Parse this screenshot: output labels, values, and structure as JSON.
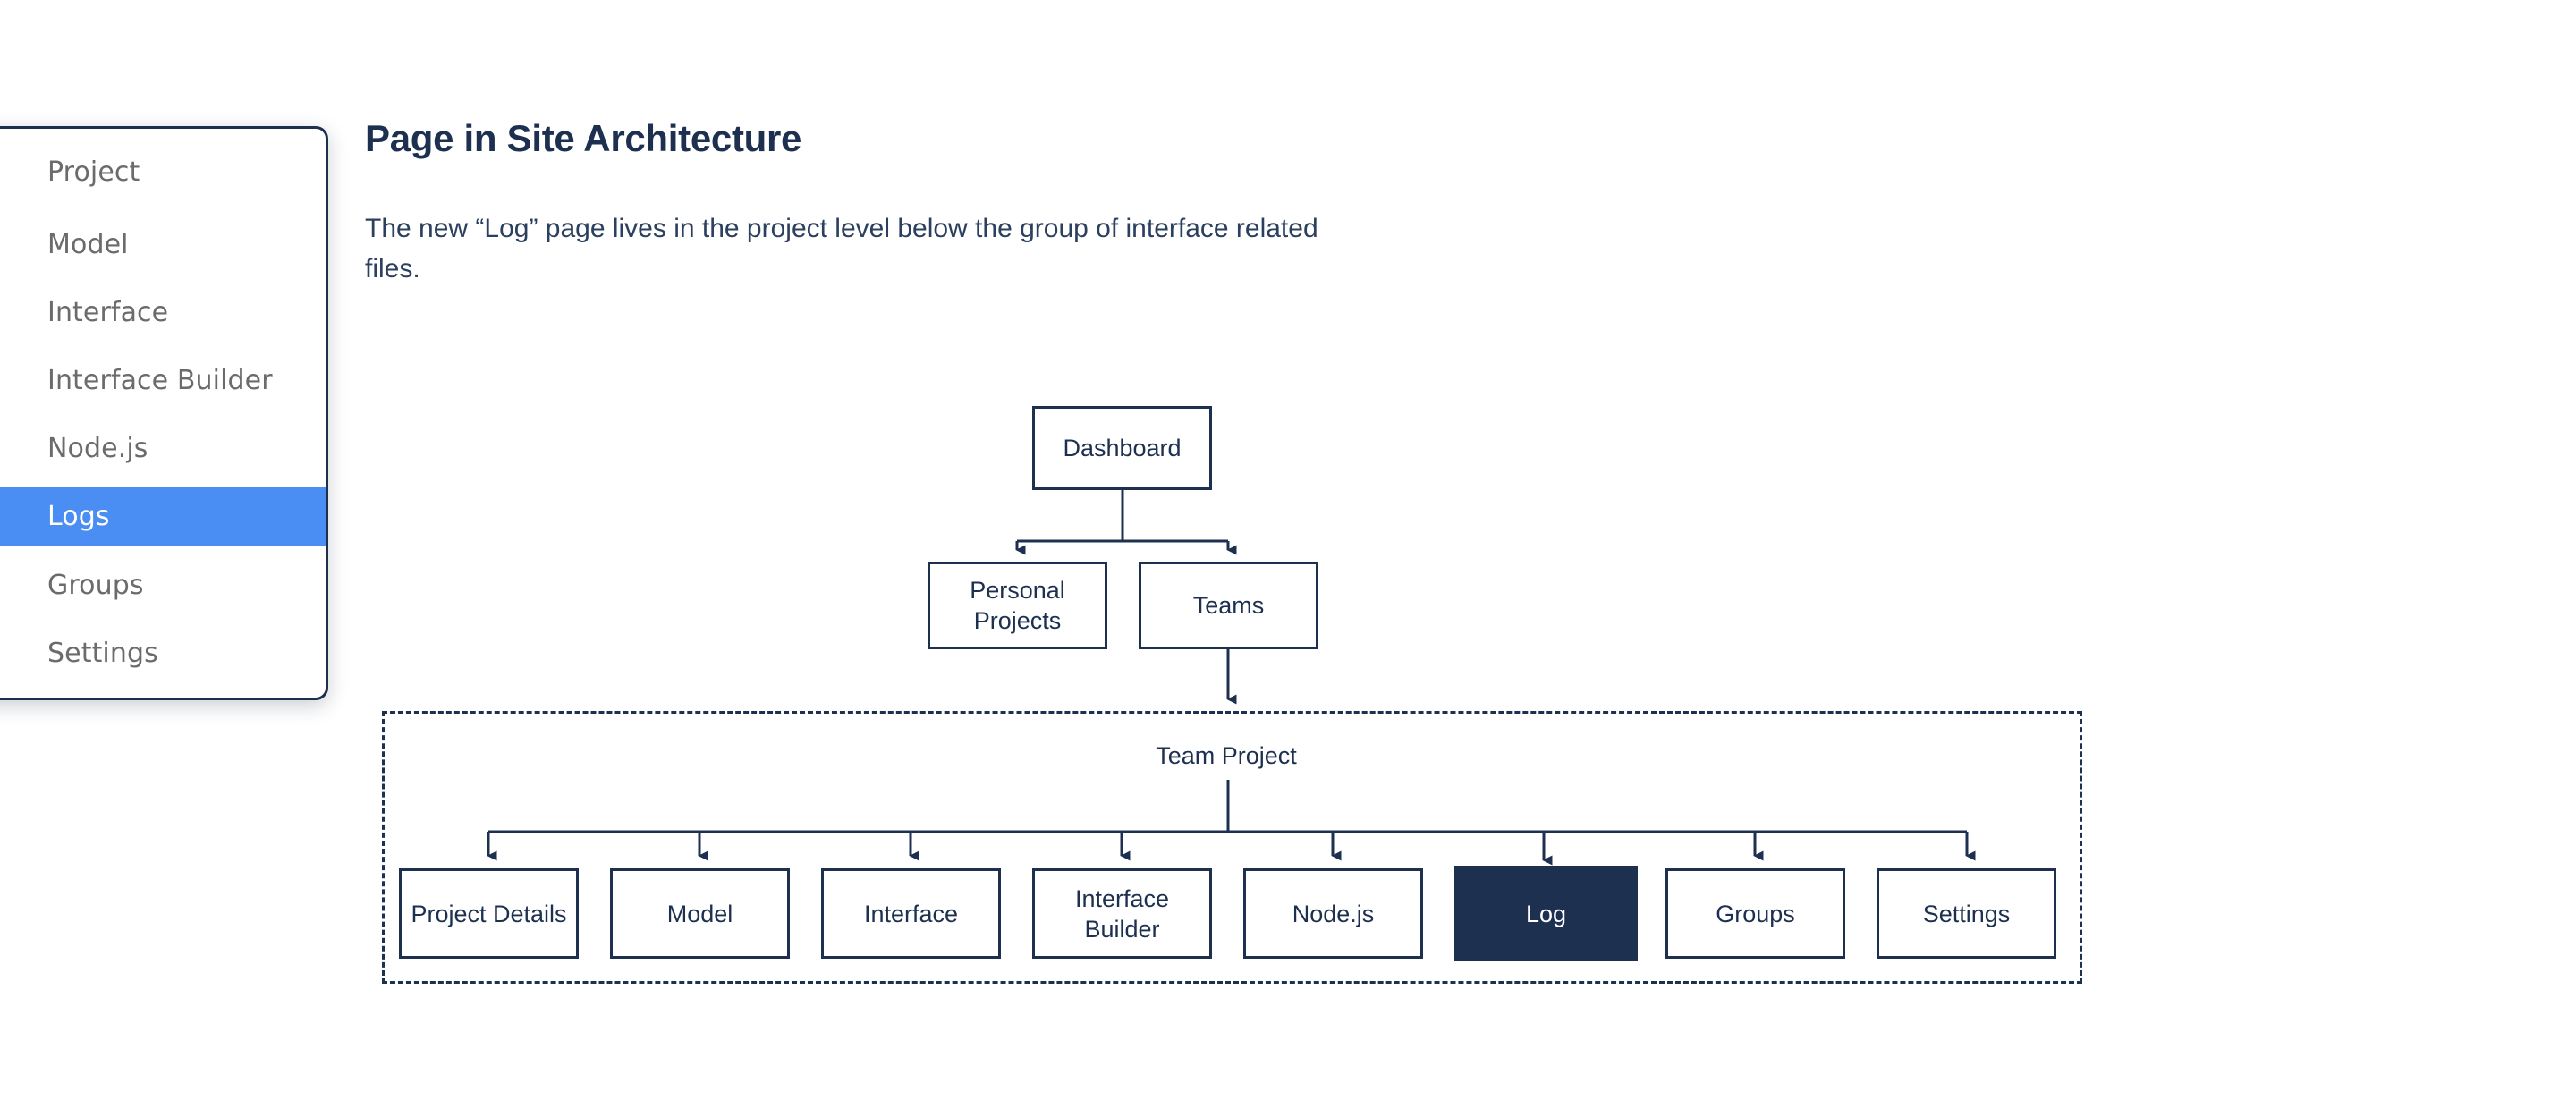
{
  "sidebar": {
    "items": [
      {
        "label": "Project",
        "active": false
      },
      {
        "label": "Model",
        "active": false
      },
      {
        "label": "Interface",
        "active": false
      },
      {
        "label": "Interface Builder",
        "active": false
      },
      {
        "label": "Node.js",
        "active": false
      },
      {
        "label": "Logs",
        "active": true
      },
      {
        "label": "Groups",
        "active": false
      },
      {
        "label": "Settings",
        "active": false
      }
    ],
    "active_label": "Logs",
    "active_color": "#4a8df3"
  },
  "header": {
    "title": "Page in Site Architecture",
    "description": "The new “Log” page lives in the project level below the group of interface related files."
  },
  "diagram": {
    "type": "tree",
    "accent_color": "#1d3050",
    "highlight_fill": "#1d3050",
    "highlight_text_color": "#ffffff",
    "group_label": "Team Project",
    "nodes": {
      "dashboard": "Dashboard",
      "personal_projects": "Personal\nProjects",
      "personal_projects_line1": "Personal",
      "personal_projects_line2": "Projects",
      "teams": "Teams"
    },
    "project_pages": [
      {
        "label": "Project Details",
        "highlighted": false
      },
      {
        "label": "Model",
        "highlighted": false
      },
      {
        "label": "Interface",
        "highlighted": false
      },
      {
        "label": "Interface Builder",
        "highlighted": false
      },
      {
        "label": "Node.js",
        "highlighted": false
      },
      {
        "label": "Log",
        "highlighted": true
      },
      {
        "label": "Groups",
        "highlighted": false
      },
      {
        "label": "Settings",
        "highlighted": false
      }
    ]
  }
}
